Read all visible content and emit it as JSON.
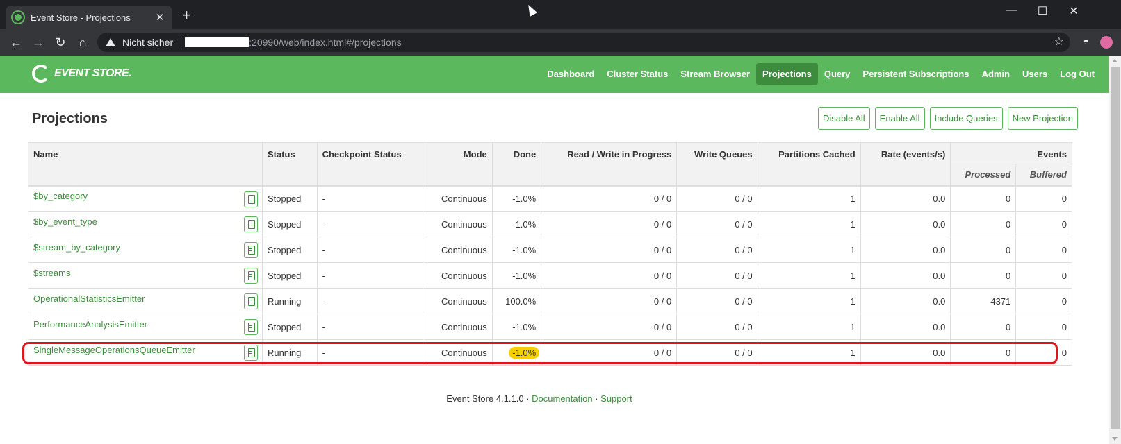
{
  "browser": {
    "tab_title": "Event Store - Projections",
    "tab_close": "✕",
    "new_tab": "+",
    "minimize": "—",
    "maximize": "☐",
    "close": "✕",
    "back": "←",
    "forward": "→",
    "reload": "↻",
    "home": "⌂",
    "security_label": "Nicht sicher",
    "url": ":20990/web/index.html#/projections",
    "star": "☆"
  },
  "app": {
    "logo_text": "EVENT STORE.",
    "nav": [
      "Dashboard",
      "Cluster Status",
      "Stream Browser",
      "Projections",
      "Query",
      "Persistent Subscriptions",
      "Admin",
      "Users",
      "Log Out"
    ],
    "active_nav": "Projections",
    "accent_color": "#5cb85c"
  },
  "page": {
    "title": "Projections",
    "buttons": {
      "disable_all": "Disable All",
      "enable_all": "Enable All",
      "include_queries": "Include Queries",
      "new_projection": "New Projection"
    }
  },
  "table": {
    "headers": {
      "name": "Name",
      "status": "Status",
      "checkpoint_status": "Checkpoint Status",
      "mode": "Mode",
      "done": "Done",
      "read_write": "Read / Write in Progress",
      "write_queues": "Write Queues",
      "partitions_cached": "Partitions Cached",
      "rate": "Rate (events/s)",
      "events": "Events",
      "processed": "Processed",
      "buffered": "Buffered"
    },
    "rows": [
      {
        "name": "$by_category",
        "status": "Stopped",
        "checkpoint": "-",
        "mode": "Continuous",
        "done": "-1.0%",
        "rw": "0 / 0",
        "wq": "0 / 0",
        "partitions": "1",
        "rate": "0.0",
        "processed": "0",
        "buffered": "0"
      },
      {
        "name": "$by_event_type",
        "status": "Stopped",
        "checkpoint": "-",
        "mode": "Continuous",
        "done": "-1.0%",
        "rw": "0 / 0",
        "wq": "0 / 0",
        "partitions": "1",
        "rate": "0.0",
        "processed": "0",
        "buffered": "0"
      },
      {
        "name": "$stream_by_category",
        "status": "Stopped",
        "checkpoint": "-",
        "mode": "Continuous",
        "done": "-1.0%",
        "rw": "0 / 0",
        "wq": "0 / 0",
        "partitions": "1",
        "rate": "0.0",
        "processed": "0",
        "buffered": "0"
      },
      {
        "name": "$streams",
        "status": "Stopped",
        "checkpoint": "-",
        "mode": "Continuous",
        "done": "-1.0%",
        "rw": "0 / 0",
        "wq": "0 / 0",
        "partitions": "1",
        "rate": "0.0",
        "processed": "0",
        "buffered": "0"
      },
      {
        "name": "OperationalStatisticsEmitter",
        "status": "Running",
        "checkpoint": "-",
        "mode": "Continuous",
        "done": "100.0%",
        "rw": "0 / 0",
        "wq": "0 / 0",
        "partitions": "1",
        "rate": "0.0",
        "processed": "4371",
        "buffered": "0"
      },
      {
        "name": "PerformanceAnalysisEmitter",
        "status": "Stopped",
        "checkpoint": "-",
        "mode": "Continuous",
        "done": "-1.0%",
        "rw": "0 / 0",
        "wq": "0 / 0",
        "partitions": "1",
        "rate": "0.0",
        "processed": "0",
        "buffered": "0"
      },
      {
        "name": "SingleMessageOperationsQueueEmitter",
        "status": "Running",
        "checkpoint": "-",
        "mode": "Continuous",
        "done": "-1.0%",
        "rw": "0 / 0",
        "wq": "0 / 0",
        "partitions": "1",
        "rate": "0.0",
        "processed": "0",
        "buffered": "0"
      }
    ]
  },
  "footer": {
    "version": "Event Store 4.1.1.0",
    "sep": " · ",
    "documentation": "Documentation",
    "support": "Support"
  }
}
